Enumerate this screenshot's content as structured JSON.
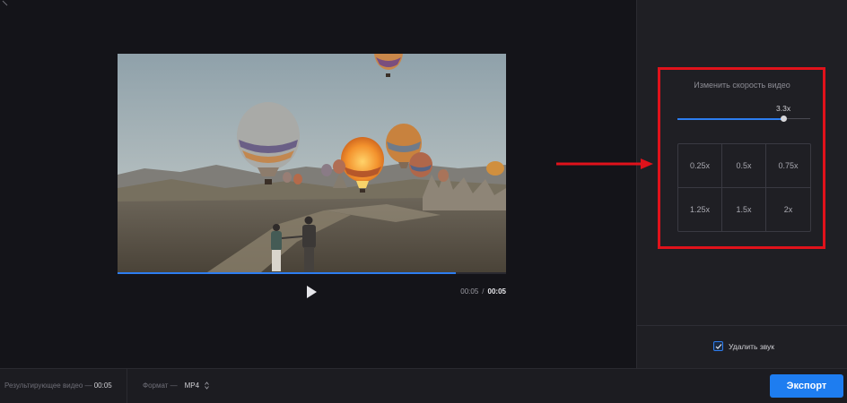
{
  "player": {
    "current_time": "00:05",
    "separator": "/",
    "duration": "00:05",
    "progress": 0.87
  },
  "speed": {
    "title": "Изменить скорость видео",
    "current_label": "3.3x",
    "slider_value": 0.8,
    "presets": [
      "0.25x",
      "0.5x",
      "0.75x",
      "1.25x",
      "1.5x",
      "2x"
    ]
  },
  "mute": {
    "label": "Удалить звук",
    "checked": true
  },
  "bottom": {
    "result_label": "Результирующее видео —",
    "result_value": "00:05",
    "format_label": "Формат —",
    "format_value": "MP4",
    "export_label": "Экспорт"
  },
  "colors": {
    "accent": "#1e7df0",
    "highlight": "#e0121b",
    "background": "#141419",
    "panel": "#1f1f24"
  }
}
